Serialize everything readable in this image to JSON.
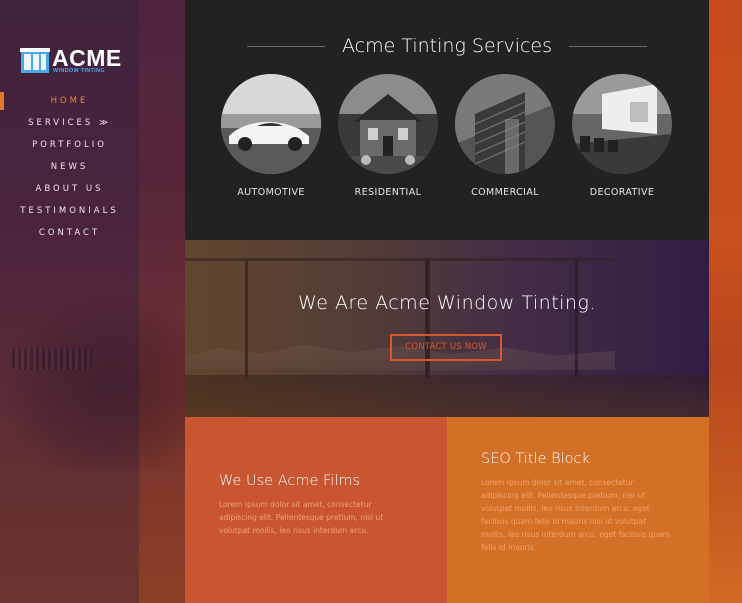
{
  "brand": {
    "name": "ACME",
    "tagline": "WINDOW TINTING",
    "colors": {
      "accent": "#e5792a",
      "tag": "#4aa8e8"
    }
  },
  "nav": {
    "items": [
      {
        "label": "HOME",
        "active": true
      },
      {
        "label": "SERVICES ≫",
        "active": false
      },
      {
        "label": "PORTFOLIO",
        "active": false
      },
      {
        "label": "NEWS",
        "active": false
      },
      {
        "label": "ABOUT US",
        "active": false
      },
      {
        "label": "TESTIMONIALS",
        "active": false
      },
      {
        "label": "CONTACT",
        "active": false
      }
    ]
  },
  "services": {
    "title": "Acme Tinting Services",
    "items": [
      {
        "label": "AUTOMOTIVE",
        "icon": "sports-car-photo"
      },
      {
        "label": "RESIDENTIAL",
        "icon": "house-photo"
      },
      {
        "label": "COMMERCIAL",
        "icon": "building-photo"
      },
      {
        "label": "DECORATIVE",
        "icon": "office-photo"
      }
    ]
  },
  "hero": {
    "title": "We Are Acme Window Tinting.",
    "button_label": "CONTACT US NOW",
    "button_color": "#d7582c"
  },
  "blocks": {
    "left": {
      "title": "We Use Acme Films",
      "text": "Lorem ipsum dolor sit amet, consectetur adipiscing elit. Pellentesque pretium, nisi ut volutpat mollis, leo risus interdum arcu.",
      "bg": "#c95630"
    },
    "right": {
      "title": "SEO Title Block",
      "text": "Lorem ipsum dolor sit amet, consectetur adipiscing elit. Pellentesque pretium, nisi ut volutpat mollis, leo risus interdum arcu, eget facilisis quam felis id mauris nisi ut volutpat mollis, leo risus interdum arcu, eget facilisis quam felis id mauris.",
      "bg": "#d46f26"
    }
  }
}
